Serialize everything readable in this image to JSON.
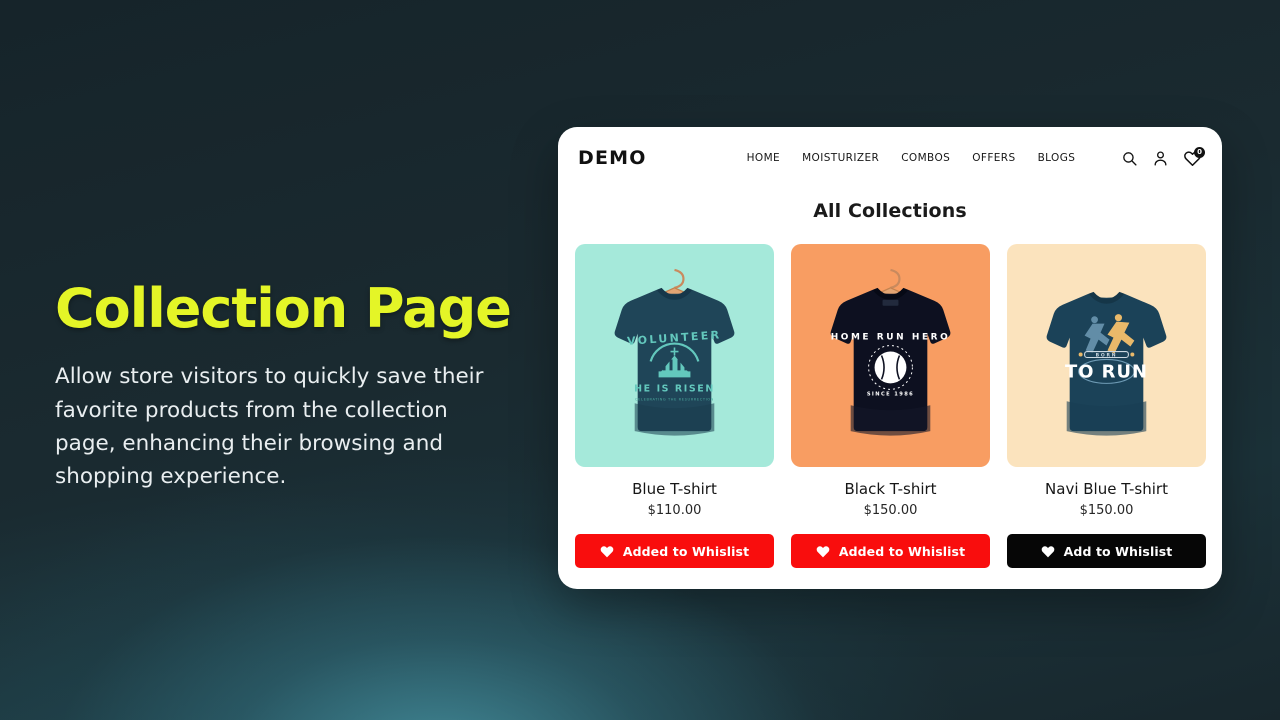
{
  "background": {
    "base_color": "#19272c",
    "glow_color": "#2f6b79"
  },
  "hero": {
    "heading": "Collection Page",
    "heading_color": "#e4f527",
    "body": "Allow store visitors to quickly save their favorite products from the collection page, enhancing their browsing and shopping experience.",
    "body_color": "#e9eef0"
  },
  "store": {
    "header": {
      "brand": "DEMO",
      "nav": [
        {
          "label": "HOME"
        },
        {
          "label": "MOISTURIZER"
        },
        {
          "label": "COMBOS"
        },
        {
          "label": "OFFERS"
        },
        {
          "label": "BLOGS"
        }
      ],
      "icons": {
        "search": "search-icon",
        "account": "user-icon",
        "wishlist": "heart-icon",
        "wishlist_badge": "0"
      }
    },
    "section_title": "All Collections",
    "products": [
      {
        "name": "Blue T-shirt",
        "price": "$110.00",
        "bg_color": "#a5e9da",
        "shirt_color": "#1f4558",
        "print_color": "#63c8bd",
        "print_top": "VOLUNTEER",
        "print_bottom": "HE IS RISEN",
        "button": {
          "label": "Added  to Whislist",
          "state": "added",
          "color": "#f90d0d"
        }
      },
      {
        "name": "Black T-shirt",
        "price": "$150.00",
        "bg_color": "#f89d62",
        "shirt_color": "#0d1020",
        "print_color": "#ffffff",
        "print_top": "HOME RUN HERO",
        "print_bottom": "SINCE 1986",
        "button": {
          "label": "Added  to Whislist",
          "state": "added",
          "color": "#f90d0d"
        }
      },
      {
        "name": "Navi Blue T-shirt",
        "price": "$150.00",
        "bg_color": "#fbe3bd",
        "shirt_color": "#1b4258",
        "print_color": "#ffffff",
        "print_top": "BORN",
        "print_bottom": "TO RUN",
        "button": {
          "label": "Add to Whislist",
          "state": "add",
          "color": "#060606"
        }
      }
    ]
  }
}
